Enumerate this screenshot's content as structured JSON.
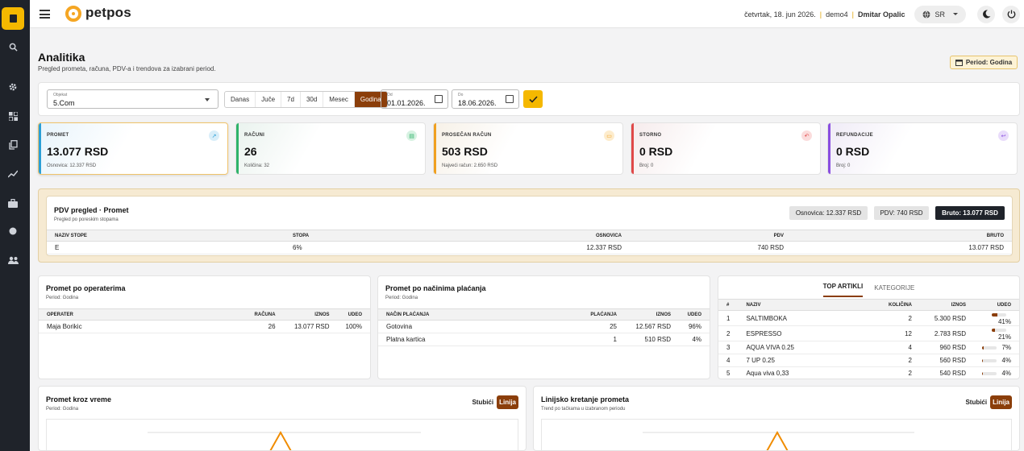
{
  "header": {
    "brand": "petpos",
    "date": "četvrtak, 18. jun 2026.",
    "tenant": "demo4",
    "user": "Dmitar Opalic",
    "language": "SR"
  },
  "sidebar": {
    "icons": [
      "dashboard-icon",
      "search-icon",
      "gear-icon",
      "grid-icon",
      "copy-icon",
      "trend-icon",
      "briefcase-icon",
      "circle-icon",
      "users-icon"
    ]
  },
  "page": {
    "title": "Analitika",
    "subtitle": "Pregled prometa, računa, PDV-a i trendova za izabrani period.",
    "period_badge": "Period: Godina"
  },
  "filters": {
    "location_label": "Objekat",
    "location_value": "5.Com",
    "ranges": [
      "Danas",
      "Juče",
      "7d",
      "30d",
      "Mesec",
      "Godina"
    ],
    "active_range": "Godina",
    "from_label": "Od",
    "from_value": "01.01.2026.",
    "to_label": "Do",
    "to_value": "18.06.2026."
  },
  "kpis": [
    {
      "title": "PROMET",
      "value": "13.077 RSD",
      "sub": "Osnovica: 12.337 RSD",
      "color": "#2a9fd6"
    },
    {
      "title": "RAČUNI",
      "value": "26",
      "sub": "Količina: 32",
      "color": "#2fb36a"
    },
    {
      "title": "PROSEČAN RAČUN",
      "value": "503 RSD",
      "sub": "Najveći račun: 2.650 RSD",
      "color": "#f0a020"
    },
    {
      "title": "STORNO",
      "value": "0 RSD",
      "sub": "Broj: 0",
      "color": "#e04848"
    },
    {
      "title": "REFUNDACIJE",
      "value": "0 RSD",
      "sub": "Broj: 0",
      "color": "#8a4fe0"
    }
  ],
  "pdv": {
    "title": "PDV pregled · Promet",
    "subtitle": "Pregled po poreskim stopama",
    "chip_base": "Osnovica: 12.337 RSD",
    "chip_vat": "PDV: 740 RSD",
    "chip_gross": "Bruto: 13.077 RSD",
    "columns": [
      "NAZIV STOPE",
      "STOPA",
      "OSNOVICA",
      "PDV",
      "BRUTO"
    ],
    "rows": [
      [
        "E",
        "6%",
        "12.337 RSD",
        "740 RSD",
        "13.077 RSD"
      ]
    ]
  },
  "operators": {
    "title": "Promet po operaterima",
    "subtitle": "Period: Godina",
    "columns": [
      "OPERATER",
      "RAČUNA",
      "IZNOS",
      "UDEO"
    ],
    "rows": [
      [
        "Maja Borikic",
        "26",
        "13.077 RSD",
        "100%"
      ]
    ]
  },
  "payments": {
    "title": "Promet po načinima plaćanja",
    "subtitle": "Period: Godina",
    "columns": [
      "NAČIN PLAĆANJA",
      "PLAĆANJA",
      "IZNOS",
      "UDEO"
    ],
    "rows": [
      [
        "Gotovina",
        "25",
        "12.567 RSD",
        "96%"
      ],
      [
        "Platna kartica",
        "1",
        "510 RSD",
        "4%"
      ]
    ]
  },
  "top": {
    "tabs": [
      "TOP ARTIKLI",
      "KATEGORIJE"
    ],
    "columns": [
      "#",
      "NAZIV",
      "KOLIČINA",
      "IZNOS",
      "UDEO"
    ],
    "rows": [
      {
        "n": "1",
        "name": "SALTIMBOKA",
        "qty": "2",
        "amount": "5.300 RSD",
        "share": "41%",
        "frac": 0.41
      },
      {
        "n": "2",
        "name": "ESPRESSO",
        "qty": "12",
        "amount": "2.783 RSD",
        "share": "21%",
        "frac": 0.21
      },
      {
        "n": "3",
        "name": "AQUA VIVA 0.25",
        "qty": "4",
        "amount": "960 RSD",
        "share": "7%",
        "frac": 0.07
      },
      {
        "n": "4",
        "name": "7 UP 0.25",
        "qty": "2",
        "amount": "560 RSD",
        "share": "4%",
        "frac": 0.04
      },
      {
        "n": "5",
        "name": "Aqua viva 0,33",
        "qty": "2",
        "amount": "540 RSD",
        "share": "4%",
        "frac": 0.04
      }
    ]
  },
  "charts": [
    {
      "title": "Promet kroz vreme",
      "subtitle": "Period: Godina",
      "toggle_a": "Stubići",
      "toggle_b": "Linija"
    },
    {
      "title": "Linijsko kretanje prometa",
      "subtitle": "Trend po tačkama u izabranom periodu",
      "toggle_a": "Stubići",
      "toggle_b": "Linija"
    }
  ]
}
